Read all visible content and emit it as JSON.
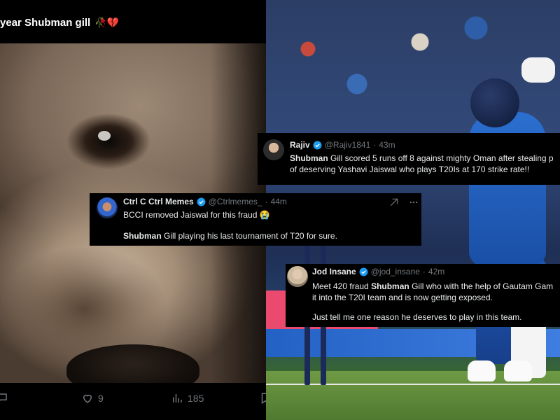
{
  "left_post": {
    "caption": "year Shubman gill",
    "caption_emojis": "🥀💔",
    "actions": {
      "reply_icon": "reply-icon",
      "like_count": "9",
      "views_count": "185",
      "bookmark_icon": "bookmark-icon"
    }
  },
  "tweets": [
    {
      "name": "Rajiv",
      "handle": "@Rajiv1841",
      "time": "43m",
      "body_lines": [
        {
          "bold": "Shubman",
          "rest": " Gill scored 5 runs off 8 against mighty Oman after stealing p"
        },
        {
          "bold": "",
          "rest": "of deserving Yashavi Jaiswal who plays T20Is at 170 strike rate!!"
        }
      ]
    },
    {
      "name": "Ctrl C Ctrl Memes",
      "handle": "@Ctrlmemes_",
      "time": "44m",
      "body_lines": [
        {
          "bold": "",
          "rest": "BCCI removed Jaiswal for this fraud 😭"
        },
        {
          "bold": "Shubman",
          "rest": " Gill playing his last tournament of T20 for sure."
        }
      ]
    },
    {
      "name": "Jod Insane",
      "handle": "@jod_insane",
      "time": "42m",
      "body_lines": [
        {
          "bold": "",
          "rest": "Meet 420 fraud ",
          "bold2": "Shubman",
          "rest2": " Gill who with the help of Gautam Gam"
        },
        {
          "bold": "",
          "rest": "it into the T20I team and is now getting exposed."
        },
        {
          "bold": "",
          "rest": "Just tell me one reason he deserves to play in this team."
        }
      ]
    }
  ],
  "separator": "·",
  "colors": {
    "verified_blue": "#1d9bf0",
    "muted_text": "#71767b",
    "text": "#e7e9ea",
    "india_blue": "#2b6fd0"
  }
}
